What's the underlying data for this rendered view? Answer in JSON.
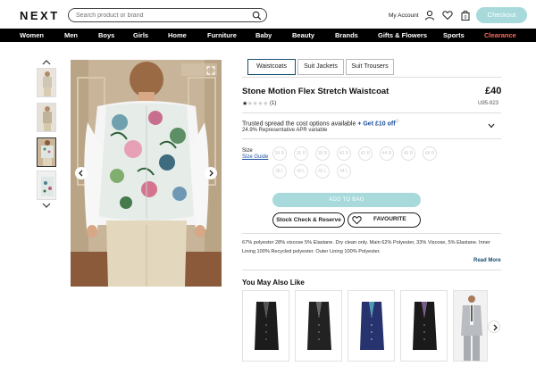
{
  "header": {
    "logo": "NEXT",
    "search_placeholder": "Search product or brand",
    "my_account": "My Account",
    "checkout": "Checkout"
  },
  "nav": {
    "items": [
      "Women",
      "Men",
      "Boys",
      "Girls",
      "Home",
      "Furniture",
      "Baby",
      "Beauty",
      "Brands",
      "Gifts & Flowers",
      "Sports",
      "Clearance"
    ]
  },
  "product": {
    "tabs": [
      "Waistcoats",
      "Suit Jackets",
      "Suit Trousers"
    ],
    "active_tab": "Waistcoats",
    "title": "Stone Motion Flex Stretch Waistcoat",
    "price": "£40",
    "code": "U95-923",
    "rating_stars": 1,
    "rating_max": 5,
    "review_count": "(1)",
    "trust_text": "Trusted spread the cost options available",
    "trust_link": "+ Get £10 off",
    "apr": "24.9% Representative APR variable",
    "size_label": "Size",
    "size_guide": "Size Guide",
    "sizes": [
      "34 R",
      "36 R",
      "38 R",
      "40 R",
      "42 R",
      "44 R",
      "46 R",
      "48 R",
      "38 L",
      "40 L",
      "42 L",
      "44 L"
    ],
    "add_to_bag": "ADD TO BAG",
    "stock_check": "Stock Check & Reserve",
    "favourite": "FAVOURITE",
    "material": "67% polyester 28% viscose 5% Elastane. Dry clean only. Main 62% Polyester, 33% Viscose, 5% Elastane. Inner Lining 100% Recycled polyester. Outer Lining 100% Polyester.",
    "read_more": "Read More"
  },
  "recommendations": {
    "title": "You May Also Like",
    "items": [
      {
        "icon": "black-waistcoat"
      },
      {
        "icon": "black-waistcoat"
      },
      {
        "icon": "navy-waistcoat"
      },
      {
        "icon": "black-floral-waistcoat"
      },
      {
        "icon": "grey-suit-model"
      }
    ]
  },
  "colors": {
    "accent": "#a8dadb",
    "link": "#1a4f9c",
    "nav_bg": "#000000",
    "clearance": "#ff6a5e"
  }
}
